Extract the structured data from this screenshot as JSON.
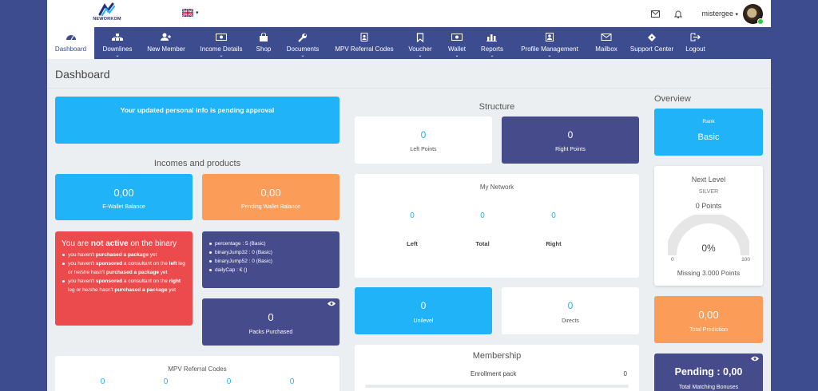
{
  "header": {
    "logo_text": "NEWORKOM",
    "username": "mistergee",
    "caret": "▾"
  },
  "nav": [
    {
      "label": "Dashboard",
      "icon": "dashboard-icon",
      "active": true,
      "dropdown": false
    },
    {
      "label": "Downlines",
      "icon": "sitemap-icon",
      "dropdown": true
    },
    {
      "label": "New Member",
      "icon": "user-plus-icon",
      "dropdown": false
    },
    {
      "label": "Income Details",
      "icon": "money-icon",
      "dropdown": true
    },
    {
      "label": "Shop",
      "icon": "shopping-bag-icon",
      "dropdown": false
    },
    {
      "label": "Documents",
      "icon": "wrench-icon",
      "dropdown": true
    },
    {
      "label": "MPV Referral Codes",
      "icon": "badge-icon",
      "dropdown": false
    },
    {
      "label": "Voucher",
      "icon": "bookmark-icon",
      "dropdown": true
    },
    {
      "label": "Wallet",
      "icon": "wallet-icon",
      "dropdown": true
    },
    {
      "label": "Reports",
      "icon": "bar-chart-icon",
      "dropdown": true
    },
    {
      "label": "Profile Management",
      "icon": "profile-icon",
      "dropdown": true
    },
    {
      "label": "Mailbox",
      "icon": "envelope-icon",
      "dropdown": false
    },
    {
      "label": "Support Center",
      "icon": "ticket-icon",
      "dropdown": false
    },
    {
      "label": "Logout",
      "icon": "sign-out-icon",
      "dropdown": false
    }
  ],
  "page_title": "Dashboard",
  "pending_msg": "Your updated personal info is pending approval",
  "incomes": {
    "title": "Incomes and products",
    "ewallet": {
      "value": "0,00",
      "label": "E-Wallet Balance"
    },
    "pending": {
      "value": "0,00",
      "label": "Pending Wallet Balance"
    }
  },
  "binary": {
    "title_pre": "You are ",
    "title_bold": "not active",
    "title_post": " on the binary",
    "items": [
      "you haven't purchased a package yet",
      "you haven't sponsored a consultant on the left leg or he/she hasn't purchased a package yet",
      "you haven't sponsored a consultant on the right leg or he/she hasn't purchased a package yet"
    ]
  },
  "params": [
    "percentage : 5 (Basic)",
    "binaryJump32 : 0 (Basic)",
    "binaryJump52 : 0 (Basic)",
    "dailyCap : € ()"
  ],
  "packs": {
    "value": "0",
    "label": "Packs Purchased"
  },
  "mpv": {
    "title": "MPV Referral Codes",
    "values": [
      "0",
      "0",
      "0",
      "0"
    ]
  },
  "structure": {
    "title": "Structure",
    "left": {
      "value": "0",
      "label": "Left Points"
    },
    "right": {
      "value": "0",
      "label": "Right Points"
    }
  },
  "network": {
    "title": "My Network",
    "left": {
      "value": "0",
      "label": "Left"
    },
    "total": {
      "value": "0",
      "label": "Total"
    },
    "right": {
      "value": "0",
      "label": "Right"
    }
  },
  "unilevel": {
    "value": "0",
    "label": "Unilevel"
  },
  "directs": {
    "value": "0",
    "label": "Directs"
  },
  "membership": {
    "title": "Membership",
    "label": "Enrollment pack",
    "value": "0"
  },
  "overview": {
    "title": "Overview",
    "rank_label": "Rank",
    "rank": "Basic",
    "next_level": "Next Level",
    "next_name": "SILVER",
    "points": "0 Points",
    "gauge_pct": "0%",
    "gauge_min": "0",
    "gauge_max": "100",
    "missing": "Missing 3.000 Points",
    "gauge_fraction": 0
  },
  "prediction": {
    "value": "0,00",
    "label": "Total Prediction"
  },
  "matching": {
    "value": "Pending : 0,00",
    "label": "Total Matching Bonuses"
  }
}
